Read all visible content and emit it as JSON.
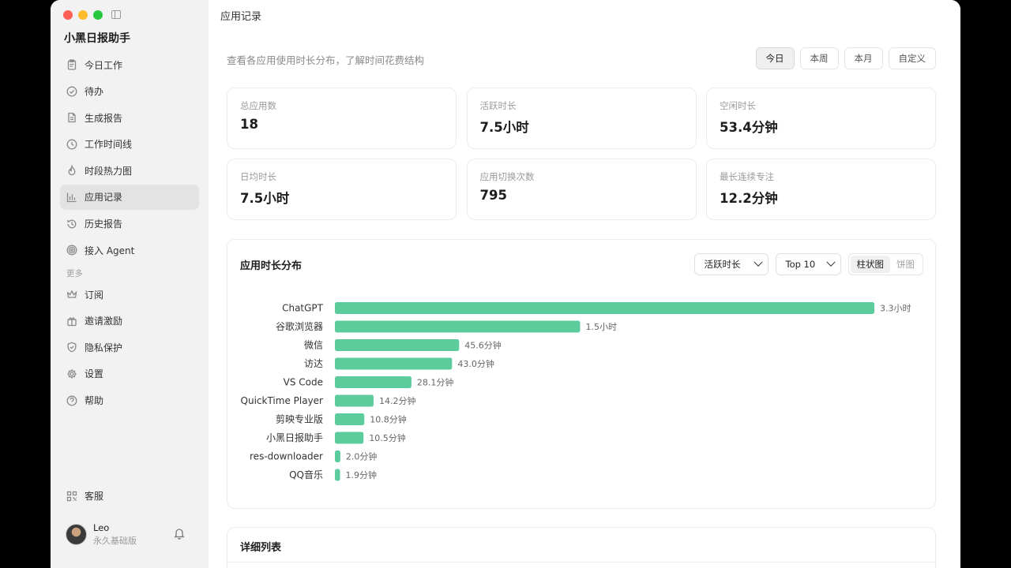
{
  "app": {
    "title": "小黑日报助手"
  },
  "sidebar": {
    "items": [
      {
        "label": "今日工作",
        "icon": "clipboard-icon"
      },
      {
        "label": "待办",
        "icon": "check-circle-icon"
      },
      {
        "label": "生成报告",
        "icon": "document-icon"
      },
      {
        "label": "工作时间线",
        "icon": "clock-icon"
      },
      {
        "label": "时段热力图",
        "icon": "flame-icon"
      },
      {
        "label": "应用记录",
        "icon": "bar-chart-icon",
        "active": true
      },
      {
        "label": "历史报告",
        "icon": "history-icon"
      },
      {
        "label": "接入 Agent",
        "icon": "spiral-icon"
      }
    ],
    "more_label": "更多",
    "more_items": [
      {
        "label": "订阅",
        "icon": "crown-icon"
      },
      {
        "label": "邀请激励",
        "icon": "gift-icon"
      },
      {
        "label": "隐私保护",
        "icon": "shield-icon"
      },
      {
        "label": "设置",
        "icon": "gear-icon"
      },
      {
        "label": "帮助",
        "icon": "help-icon"
      }
    ],
    "support_label": "客服",
    "user": {
      "name": "Leo",
      "plan": "永久基础版"
    }
  },
  "main": {
    "header": "应用记录",
    "subtitle": "查看各应用使用时长分布，了解时间花费结构",
    "range_tabs": [
      "今日",
      "本周",
      "本月",
      "自定义"
    ],
    "active_range": "今日",
    "stats": [
      {
        "label": "总应用数",
        "value": "18"
      },
      {
        "label": "活跃时长",
        "value": "7.5小时"
      },
      {
        "label": "空闲时长",
        "value": "53.4分钟"
      },
      {
        "label": "日均时长",
        "value": "7.5小时"
      },
      {
        "label": "应用切换次数",
        "value": "795"
      },
      {
        "label": "最长连续专注",
        "value": "12.2分钟"
      }
    ],
    "chart_card": {
      "title": "应用时长分布",
      "metric_select": "活跃时长",
      "top_select": "Top 10",
      "view_options": [
        "柱状图",
        "饼图"
      ],
      "active_view": "柱状图"
    },
    "detail_title": "详细列表"
  },
  "chart_data": {
    "type": "bar",
    "orientation": "horizontal",
    "unit": "minutes",
    "categories": [
      "ChatGPT",
      "谷歌浏览器",
      "微信",
      "访达",
      "VS Code",
      "QuickTime Player",
      "剪映专业版",
      "小黑日报助手",
      "res-downloader",
      "QQ音乐"
    ],
    "values": [
      198,
      90,
      45.6,
      43.0,
      28.1,
      14.2,
      10.8,
      10.5,
      2.0,
      1.9
    ],
    "labels": [
      "3.3小时",
      "1.5小时",
      "45.6分钟",
      "43.0分钟",
      "28.1分钟",
      "14.2分钟",
      "10.8分钟",
      "10.5分钟",
      "2.0分钟",
      "1.9分钟"
    ],
    "color": "#5ccc9d",
    "grid": false
  }
}
